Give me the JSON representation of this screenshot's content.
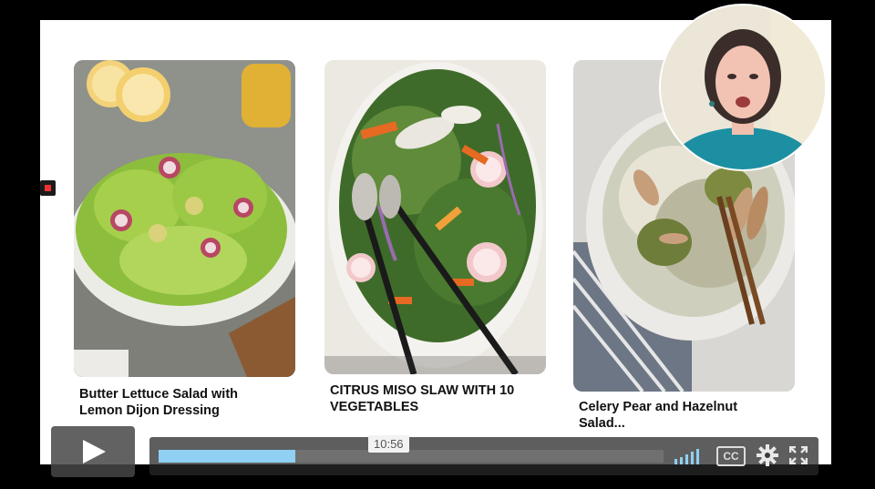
{
  "recipes": [
    {
      "title_line1": "Butter Lettuce Salad with",
      "title_line2": "Lemon Dijon Dressing"
    },
    {
      "title_line1": "CITRUS MISO SLAW WITH 10",
      "title_line2": "VEGETABLES"
    },
    {
      "title_line1": "Celery Pear and Hazelnut",
      "title_line2": "Salad..."
    }
  ],
  "player": {
    "timestamp": "10:56",
    "progress_fraction": 0.27,
    "cc_label": "CC",
    "icons": [
      "play-icon",
      "volume-icon",
      "closed-captions-icon",
      "settings-gear-icon",
      "fullscreen-icon"
    ]
  },
  "colors": {
    "progress_fill": "#8fd0f3",
    "recording_marker": "#e33333"
  }
}
